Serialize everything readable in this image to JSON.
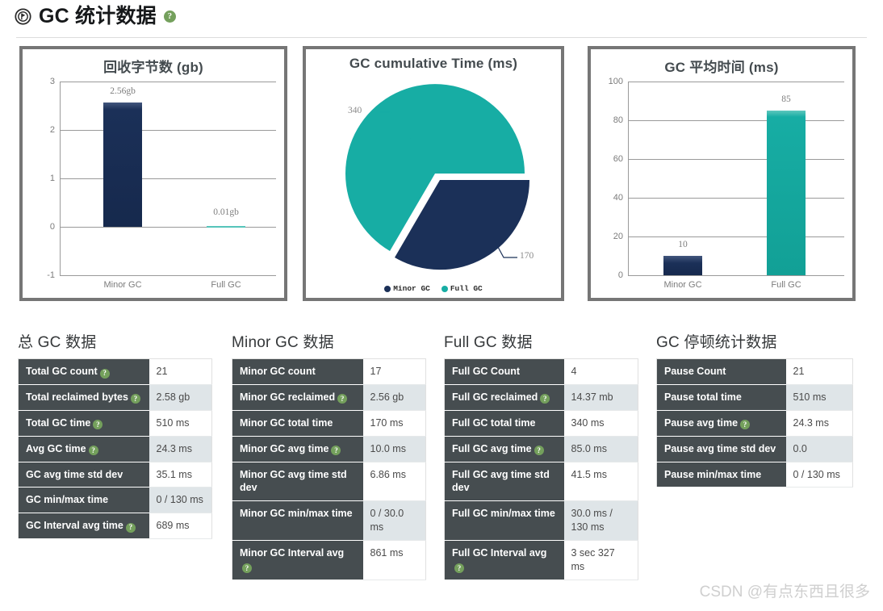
{
  "header": {
    "title": "GC 统计数据",
    "icon": "compass-icon",
    "help_icon": "help-icon",
    "help_glyph": "?"
  },
  "colors": {
    "navy": "#1b3058",
    "teal": "#17ada4",
    "panel_border": "#767676",
    "table_header_bg": "#464d50",
    "help_green": "#74a05c"
  },
  "charts": [
    {
      "chart_data": {
        "type": "bar",
        "title": "回收字节数 (gb)",
        "categories": [
          "Minor GC",
          "Full GC"
        ],
        "values": [
          2.56,
          0.01
        ],
        "data_labels": [
          "2.56gb",
          "0.01gb"
        ],
        "colors": [
          "#1b3058",
          "#17ada4"
        ],
        "xlabel": "",
        "ylabel": "",
        "ylim": [
          -1,
          3
        ],
        "yticks": [
          "3",
          "2",
          "1",
          "0",
          "-1"
        ],
        "grid": true,
        "legend": false
      }
    },
    {
      "chart_data": {
        "type": "pie",
        "title": "GC cumulative Time (ms)",
        "labels": [
          "Minor GC",
          "Full GC"
        ],
        "values": [
          170,
          340
        ],
        "data_labels": [
          "170",
          "340"
        ],
        "colors": [
          "#1b3058",
          "#17ada4"
        ],
        "legend": [
          "Minor GC",
          "Full GC"
        ],
        "legend_position": "bottom",
        "exploded_slice": "Minor GC"
      }
    },
    {
      "chart_data": {
        "type": "bar",
        "title": "GC 平均时间 (ms)",
        "categories": [
          "Minor GC",
          "Full GC"
        ],
        "values": [
          10,
          85
        ],
        "data_labels": [
          "10",
          "85"
        ],
        "colors": [
          "#1b3058",
          "#17ada4"
        ],
        "xlabel": "",
        "ylabel": "",
        "ylim": [
          0,
          100
        ],
        "yticks": [
          "100",
          "80",
          "60",
          "40",
          "20",
          "0"
        ],
        "grid": true,
        "legend": false
      }
    }
  ],
  "tables": [
    {
      "heading": "总 GC 数据",
      "rows": [
        {
          "key": "Total GC count",
          "help": true,
          "value": "21"
        },
        {
          "key": "Total reclaimed bytes",
          "help": true,
          "value": "2.58 gb"
        },
        {
          "key": "Total GC time",
          "help": true,
          "value": "510 ms"
        },
        {
          "key": "Avg GC time",
          "help": true,
          "value": "24.3 ms"
        },
        {
          "key": "GC avg time std dev",
          "help": false,
          "value": "35.1 ms"
        },
        {
          "key": "GC min/max time",
          "help": false,
          "value": "0 / 130 ms"
        },
        {
          "key": "GC Interval avg time",
          "help": true,
          "value": "689 ms"
        }
      ]
    },
    {
      "heading": "Minor GC 数据",
      "rows": [
        {
          "key": "Minor GC count",
          "help": false,
          "value": "17"
        },
        {
          "key": "Minor GC reclaimed",
          "help": true,
          "value": "2.56 gb"
        },
        {
          "key": "Minor GC total time",
          "help": false,
          "value": "170 ms"
        },
        {
          "key": "Minor GC avg time",
          "help": true,
          "value": "10.0 ms"
        },
        {
          "key": "Minor GC avg time std dev",
          "help": false,
          "value": "6.86 ms"
        },
        {
          "key": "Minor GC min/max time",
          "help": false,
          "value": "0 / 30.0 ms"
        },
        {
          "key": "Minor GC Interval avg",
          "help": true,
          "value": "861 ms"
        }
      ]
    },
    {
      "heading": "Full GC 数据",
      "rows": [
        {
          "key": "Full GC Count",
          "help": false,
          "value": "4"
        },
        {
          "key": "Full GC reclaimed",
          "help": true,
          "value": "14.37 mb"
        },
        {
          "key": "Full GC total time",
          "help": false,
          "value": "340 ms"
        },
        {
          "key": "Full GC avg time",
          "help": true,
          "value": "85.0 ms"
        },
        {
          "key": "Full GC avg time std dev",
          "help": false,
          "value": "41.5 ms"
        },
        {
          "key": "Full GC min/max time",
          "help": false,
          "value": "30.0 ms / 130 ms"
        },
        {
          "key": "Full GC Interval avg",
          "help": true,
          "value": "3 sec 327 ms"
        }
      ]
    },
    {
      "heading": "GC 停顿统计数据",
      "rows": [
        {
          "key": "Pause Count",
          "help": false,
          "value": "21"
        },
        {
          "key": "Pause total time",
          "help": false,
          "value": "510 ms"
        },
        {
          "key": "Pause avg time",
          "help": true,
          "value": "24.3 ms"
        },
        {
          "key": "Pause avg time std dev",
          "help": false,
          "value": "0.0"
        },
        {
          "key": "Pause min/max time",
          "help": false,
          "value": "0 / 130 ms"
        }
      ]
    }
  ],
  "watermark": "CSDN @有点东西且很多"
}
